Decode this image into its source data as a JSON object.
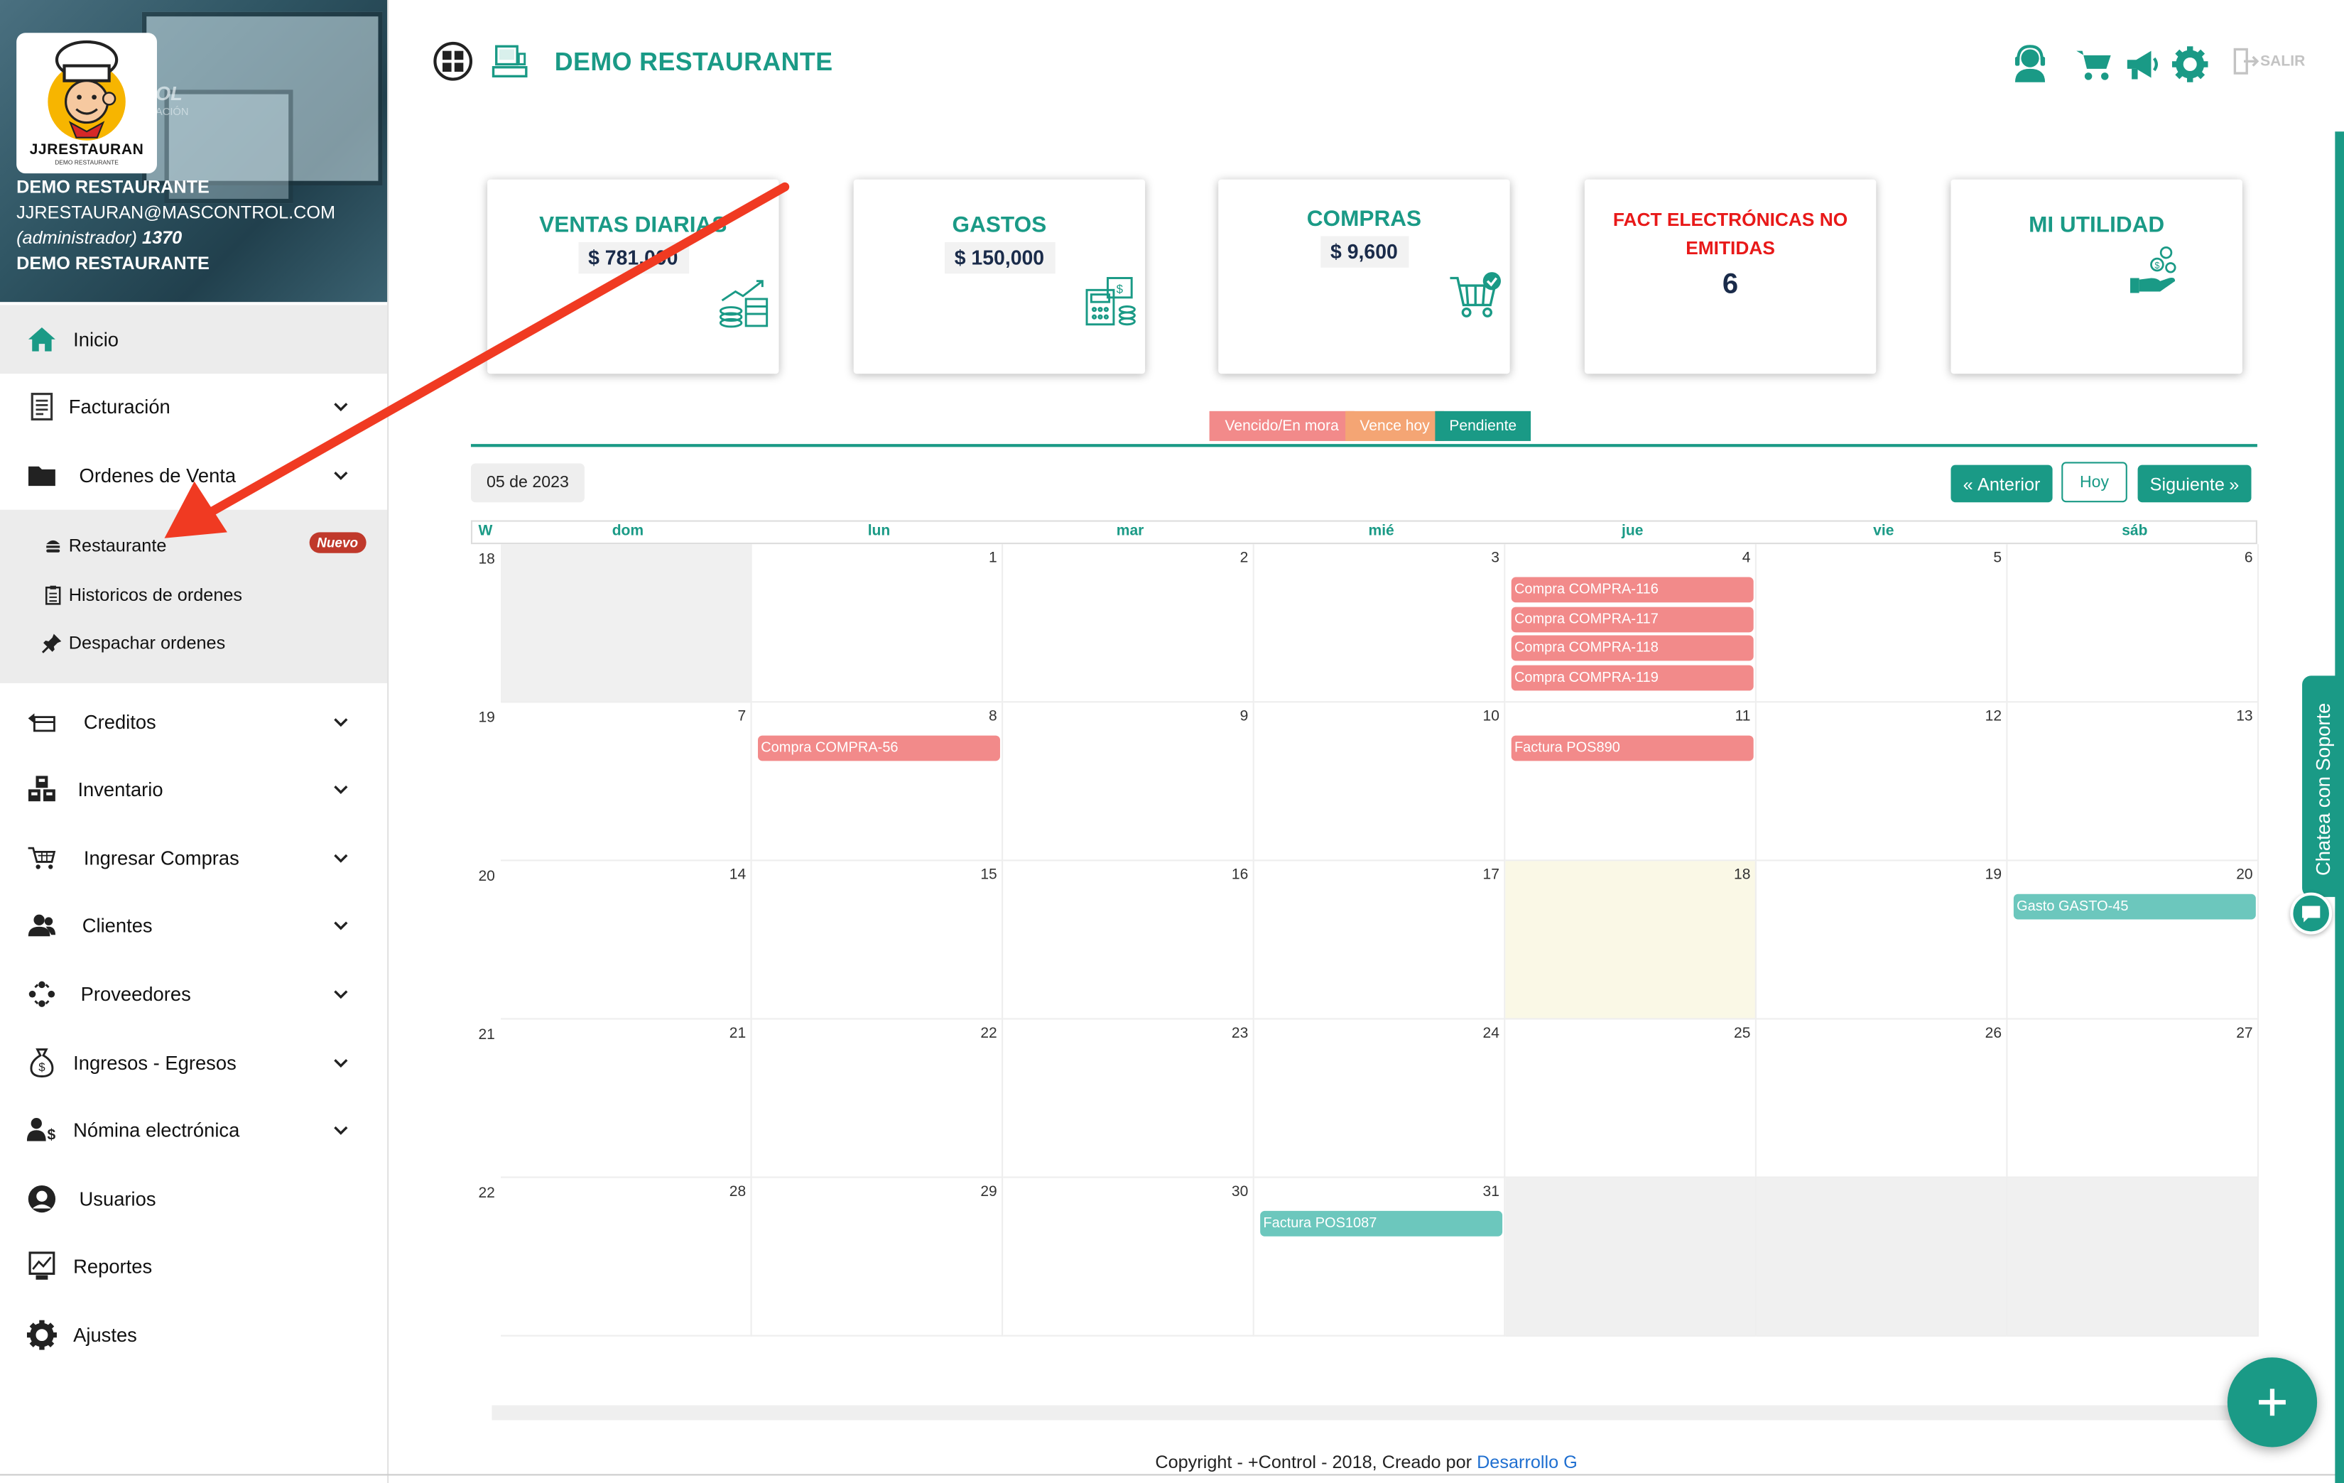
{
  "sidebar": {
    "logo": {
      "name": "JJRESTAURAN",
      "tagline": "DEMO RESTAURANTE"
    },
    "background_brand": {
      "a": "OL",
      "b": "ACIÓN"
    },
    "company": "DEMO RESTAURANTE",
    "email": "JJRESTAURAN@MASCONTROL.COM",
    "role": "(administrador)",
    "user_id": "1370",
    "branch": "DEMO RESTAURANTE",
    "items": [
      {
        "label": "Inicio",
        "icon": "home-icon",
        "active": true
      },
      {
        "label": "Facturación",
        "icon": "invoice-icon"
      },
      {
        "label": "Ordenes de Venta",
        "icon": "folder-icon",
        "expanded": true
      },
      {
        "label": "Creditos",
        "icon": "credit-icon"
      },
      {
        "label": "Inventario",
        "icon": "boxes-icon"
      },
      {
        "label": "Ingresar Compras",
        "icon": "cart-icon"
      },
      {
        "label": "Clientes",
        "icon": "users-icon"
      },
      {
        "label": "Proveedores",
        "icon": "suppliers-icon"
      },
      {
        "label": "Ingresos - Egresos",
        "icon": "moneybag-icon"
      },
      {
        "label": "Nómina electrónica",
        "icon": "payroll-icon"
      },
      {
        "label": "Usuarios",
        "icon": "user-circle-icon"
      },
      {
        "label": "Reportes",
        "icon": "report-icon"
      },
      {
        "label": "Ajustes",
        "icon": "gear-icon"
      }
    ],
    "subitems": [
      {
        "label": "Restaurante",
        "badge": "Nuevo",
        "icon": "hamburger-icon"
      },
      {
        "label": "Historicos de ordenes",
        "icon": "clipboard-icon"
      },
      {
        "label": "Despachar ordenes",
        "icon": "pin-icon"
      }
    ]
  },
  "header": {
    "title": "DEMO RESTAURANTE",
    "icons": [
      "support-agent-icon",
      "cart-icon",
      "megaphone-icon",
      "gear-icon"
    ],
    "logout": "SALIR"
  },
  "cards": [
    {
      "title": "VENTAS DIARIAS",
      "value": "$ 781,000",
      "icon": "sales-growth-icon"
    },
    {
      "title": "GASTOS",
      "value": "$ 150,000",
      "icon": "calculator-money-icon"
    },
    {
      "title": "COMPRAS",
      "value": "$ 9,600",
      "icon": "cart-check-icon"
    },
    {
      "title_line1": "FACT ELECTRÓNICAS NO",
      "title_line2": "EMITIDAS",
      "value": "6"
    },
    {
      "title": "MI UTILIDAD",
      "icon": "hand-coins-icon"
    }
  ],
  "legend": [
    {
      "label": "Vencido/En mora",
      "color": "#f28a8a"
    },
    {
      "label": "Vence hoy",
      "color": "#f4a574"
    },
    {
      "label": "Pendiente",
      "color": "#1a9a86"
    }
  ],
  "calendar": {
    "month_label": "05 de 2023",
    "nav": {
      "prev": "Anterior",
      "today": "Hoy",
      "next": "Siguiente"
    },
    "week_col": "W",
    "days": [
      "dom",
      "lun",
      "mar",
      "mié",
      "jue",
      "vie",
      "sáb"
    ],
    "weeks": [
      {
        "week": "18",
        "dates": [
          "",
          "1",
          "2",
          "3",
          "4",
          "5",
          "6"
        ]
      },
      {
        "week": "19",
        "dates": [
          "7",
          "8",
          "9",
          "10",
          "11",
          "12",
          "13"
        ]
      },
      {
        "week": "20",
        "dates": [
          "14",
          "15",
          "16",
          "17",
          "18",
          "19",
          "20"
        ]
      },
      {
        "week": "21",
        "dates": [
          "21",
          "22",
          "23",
          "24",
          "25",
          "26",
          "27"
        ]
      },
      {
        "week": "22",
        "dates": [
          "28",
          "29",
          "30",
          "31",
          "",
          "",
          ""
        ]
      }
    ],
    "events": [
      {
        "label": "Compra COMPRA-116",
        "week": 0,
        "day": 4,
        "slot": 0,
        "status": "overdue"
      },
      {
        "label": "Compra COMPRA-117",
        "week": 0,
        "day": 4,
        "slot": 1,
        "status": "overdue"
      },
      {
        "label": "Compra COMPRA-118",
        "week": 0,
        "day": 4,
        "slot": 2,
        "status": "overdue"
      },
      {
        "label": "Compra COMPRA-119",
        "week": 0,
        "day": 4,
        "slot": 3,
        "status": "overdue"
      },
      {
        "label": "Compra COMPRA-56",
        "week": 1,
        "day": 1,
        "slot": 0,
        "status": "overdue"
      },
      {
        "label": "Factura POS890",
        "week": 1,
        "day": 4,
        "slot": 0,
        "status": "overdue"
      },
      {
        "label": "Gasto GASTO-45",
        "week": 2,
        "day": 6,
        "slot": 0,
        "status": "pending"
      },
      {
        "label": "Factura POS1087",
        "week": 4,
        "day": 3,
        "slot": 0,
        "status": "pending"
      }
    ],
    "today": {
      "week": 2,
      "day": 4
    }
  },
  "footer": {
    "copyright": "Copyright - +Control - 2018, Creado por ",
    "link": "Desarrollo G"
  },
  "support": {
    "label": "Chatea con Soporte"
  },
  "colors": {
    "brand": "#1a9a86",
    "overdue": "#f28a8a",
    "due_today": "#f4a574",
    "pending": "#6cc7bd",
    "today_bg": "#faf8e6"
  }
}
